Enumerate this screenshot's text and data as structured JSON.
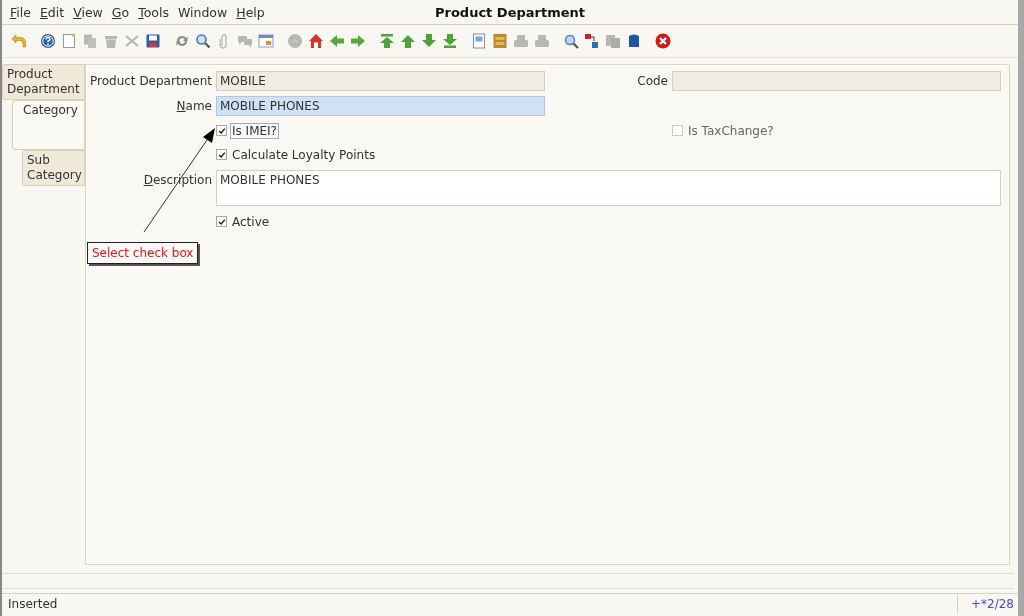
{
  "menu": [
    {
      "label": "File",
      "mnemonic": true
    },
    {
      "label": "Edit",
      "mnemonic": true
    },
    {
      "label": "View",
      "mnemonic": true
    },
    {
      "label": "Go",
      "mnemonic": true
    },
    {
      "label": "Tools",
      "mnemonic": true
    },
    {
      "label": "Window",
      "mnemonic": false
    },
    {
      "label": "Help",
      "mnemonic": true
    }
  ],
  "window": {
    "title": "Product Department"
  },
  "toolbar": [
    [
      {
        "kind": "undo",
        "disabled": false
      }
    ],
    [
      {
        "kind": "help",
        "disabled": false
      },
      {
        "kind": "new",
        "disabled": false
      },
      {
        "kind": "copy",
        "disabled": true
      },
      {
        "kind": "delete",
        "disabled": true
      },
      {
        "kind": "cut",
        "disabled": true
      },
      {
        "kind": "save",
        "disabled": false
      }
    ],
    [
      {
        "kind": "refresh",
        "disabled": false
      },
      {
        "kind": "find",
        "disabled": false
      },
      {
        "kind": "attach",
        "disabled": true
      },
      {
        "kind": "chat",
        "disabled": true
      },
      {
        "kind": "grid",
        "disabled": false
      }
    ],
    [
      {
        "kind": "history",
        "disabled": true
      },
      {
        "kind": "home",
        "disabled": false
      },
      {
        "kind": "back",
        "disabled": false
      },
      {
        "kind": "forward",
        "disabled": false
      }
    ],
    [
      {
        "kind": "first",
        "disabled": false
      },
      {
        "kind": "up",
        "disabled": false
      },
      {
        "kind": "down",
        "disabled": false
      },
      {
        "kind": "last",
        "disabled": false
      }
    ],
    [
      {
        "kind": "report",
        "disabled": false
      },
      {
        "kind": "archive",
        "disabled": false
      },
      {
        "kind": "print",
        "disabled": true
      },
      {
        "kind": "print",
        "disabled": true
      }
    ],
    [
      {
        "kind": "zoom",
        "disabled": false
      },
      {
        "kind": "workflow",
        "disabled": false
      },
      {
        "kind": "product",
        "disabled": true
      },
      {
        "kind": "box",
        "disabled": false
      }
    ],
    [
      {
        "kind": "close",
        "disabled": false
      }
    ]
  ],
  "tabs": [
    {
      "label": "Product Department",
      "selected": false,
      "children": [
        {
          "label": "Category",
          "selected": true,
          "children": [
            {
              "label": "Sub Category",
              "selected": false
            }
          ]
        }
      ]
    }
  ],
  "form": {
    "department": {
      "label": "Product Department",
      "value": "MOBILE"
    },
    "code": {
      "label": "Code"
    },
    "name": {
      "label": "Name",
      "mnemonic": true,
      "value": "MOBILE PHONES"
    },
    "is_imei": {
      "label": "Is IMEI?",
      "checked": true,
      "focused": true
    },
    "is_taxchange": {
      "label": "Is TaxChange?",
      "checked": false,
      "disabled": true
    },
    "loyalty": {
      "label": "Calculate Loyalty Points",
      "checked": true
    },
    "description": {
      "label": "Description",
      "mnemonic": true,
      "value": "MOBILE PHONES"
    },
    "active": {
      "label": "Active",
      "checked": true
    }
  },
  "callout": {
    "text": "Select check box"
  },
  "status_bar": {
    "message": "Inserted",
    "record": "+*2/28"
  }
}
